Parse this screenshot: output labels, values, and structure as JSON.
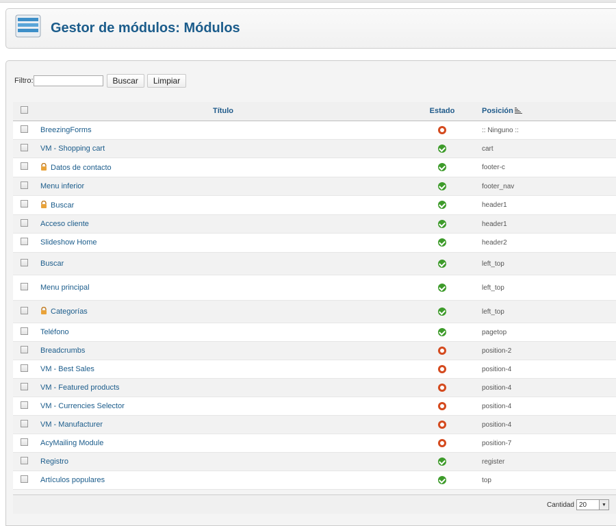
{
  "header": {
    "title": "Gestor de módulos: Módulos"
  },
  "filter": {
    "label": "Filtro:",
    "value": "",
    "search_label": "Buscar",
    "clear_label": "Limpiar"
  },
  "table": {
    "columns": {
      "title": "Título",
      "status": "Estado",
      "position": "Posición"
    },
    "rows": [
      {
        "title": "BreezingForms",
        "status": "off",
        "position": ":: Ninguno ::",
        "locked": false
      },
      {
        "title": "VM - Shopping cart",
        "status": "ok",
        "position": "cart",
        "locked": false
      },
      {
        "title": "Datos de contacto",
        "status": "ok",
        "position": "footer-c",
        "locked": true
      },
      {
        "title": "Menu inferior",
        "status": "ok",
        "position": "footer_nav",
        "locked": false
      },
      {
        "title": "Buscar",
        "status": "ok",
        "position": "header1",
        "locked": true
      },
      {
        "title": "Acceso cliente",
        "status": "ok",
        "position": "header1",
        "locked": false
      },
      {
        "title": "Slideshow Home",
        "status": "ok",
        "position": "header2",
        "locked": false
      },
      {
        "title": "Buscar",
        "status": "ok",
        "position": "left_top",
        "locked": false
      },
      {
        "title": "Menu principal",
        "status": "ok",
        "position": "left_top",
        "locked": false
      },
      {
        "title": "Categorías",
        "status": "ok",
        "position": "left_top",
        "locked": true
      },
      {
        "title": "Teléfono",
        "status": "ok",
        "position": "pagetop",
        "locked": false
      },
      {
        "title": "Breadcrumbs",
        "status": "off",
        "position": "position-2",
        "locked": false
      },
      {
        "title": "VM - Best Sales",
        "status": "off",
        "position": "position-4",
        "locked": false
      },
      {
        "title": "VM - Featured products",
        "status": "off",
        "position": "position-4",
        "locked": false
      },
      {
        "title": "VM - Currencies Selector",
        "status": "off",
        "position": "position-4",
        "locked": false
      },
      {
        "title": "VM - Manufacturer",
        "status": "off",
        "position": "position-4",
        "locked": false
      },
      {
        "title": "AcyMailing Module",
        "status": "off",
        "position": "position-7",
        "locked": false
      },
      {
        "title": "Registro",
        "status": "ok",
        "position": "register",
        "locked": false
      },
      {
        "title": "Artículos populares",
        "status": "ok",
        "position": "top",
        "locked": false
      }
    ]
  },
  "footer": {
    "limit_label": "Cantidad",
    "limit_value": "20"
  },
  "colors": {
    "title": "#1b5c8b",
    "published": "#3d9b2a",
    "unpublished": "#d44a1e"
  }
}
